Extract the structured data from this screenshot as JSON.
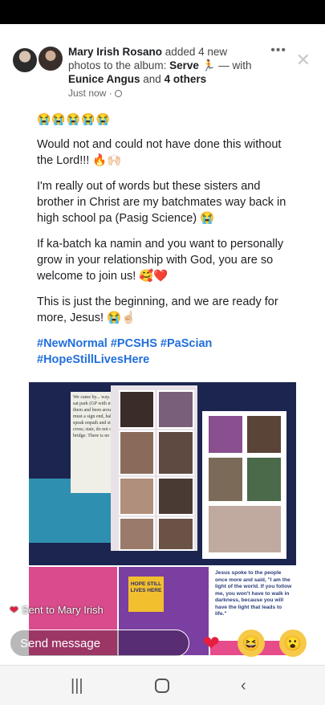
{
  "post": {
    "author": "Mary Irish Rosano",
    "action": "added 4 new photos to the album:",
    "album": "Serve",
    "with_text": "— with",
    "tagged_name": "Eunice Angus",
    "and_text": "and",
    "others": "4 others",
    "timestamp": "Just now ·"
  },
  "body": {
    "emojis": "😭😭😭😭😭",
    "p1": "Would not and could not have done this without the Lord!!! 🔥🙌🏻",
    "p2": "I'm really out of words but these sisters and brother in Christ are my batchmates way back in high school pa (Pasig Science) 😭",
    "p3": "If ka-batch ka namin and you want to personally grow in your relationship with God, you are so welcome to join us! 🥰❤️",
    "p4": "This is just the beginning, and we are ready for more, Jesus! 😭☝🏻",
    "hashtags_line1": "#NewNormal #PCSHS #PaScian",
    "hashtags_line2": "#HopeStillLivesHere"
  },
  "collage": {
    "paper_text": "We came by... way. Longville... sat park (GP with map... more of them and been around the you must a sign end, half right, to the speak enpath and stair; do not cross; stair, do not cross. w bridge. There is no northern bank."
  },
  "cards": {
    "hope_text": "HOPE STILL LIVES HERE",
    "quote": "Jesus spoke to the people once more and said, \"I am the light of the world. If you follow me, you won't have to walk in darkness, because you will have the light that leads to life.\""
  },
  "reply": {
    "sent_text": "Sent to Mary Irish",
    "send_placeholder": "Send message"
  },
  "icons": {
    "more": "more-options-icon",
    "close": "close-icon",
    "globe": "globe-icon"
  },
  "colors": {
    "hashtag": "#216fdb",
    "heart": "#e41e3f"
  }
}
